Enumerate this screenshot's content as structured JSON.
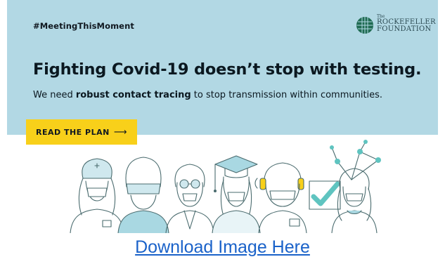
{
  "banner": {
    "hashtag": "#MeetingThisMoment",
    "headline": "Fighting Covid-19 doesn’t stop with testing.",
    "subline_before": "We need ",
    "subline_bold": "robust contact tracing",
    "subline_after": " to stop transmission within communities.",
    "cta_label": "READ THE PLAN",
    "cta_arrow": "⟶",
    "colors": {
      "background": "#b2d8e4",
      "cta": "#f8d01a",
      "accent": "#5fc4c0"
    }
  },
  "logo": {
    "the": "The",
    "line1": "ROCKEFELLER",
    "line2": "FOUNDATION"
  },
  "illustration": {
    "icons": [
      "nurse-icon",
      "welder-icon",
      "scientist-icon",
      "graduate-icon",
      "call-center-icon",
      "checkmark-icon",
      "contact-network-icon"
    ]
  },
  "download_link": "Download Image Here"
}
